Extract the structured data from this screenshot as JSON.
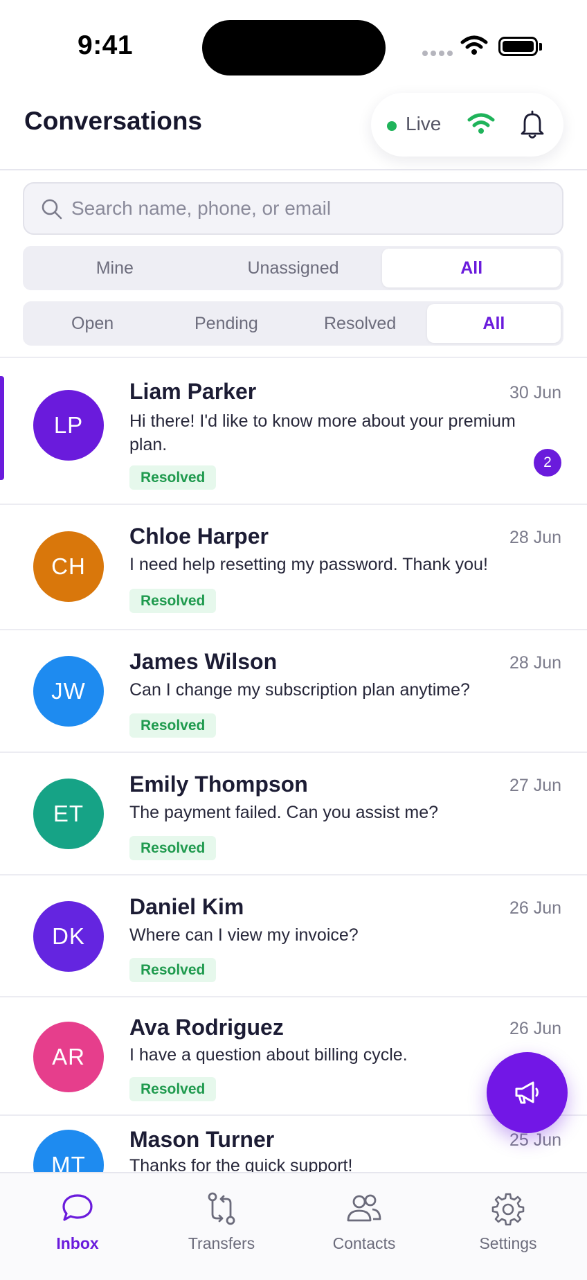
{
  "status_bar": {
    "time": "9:41"
  },
  "header": {
    "title": "Conversations",
    "live_label": "Live"
  },
  "search": {
    "placeholder": "Search name, phone, or email"
  },
  "filters": {
    "assignment": [
      "Mine",
      "Unassigned",
      "All"
    ],
    "assignment_selected": "All",
    "status": [
      "Open",
      "Pending",
      "Resolved",
      "All"
    ],
    "status_selected": "All"
  },
  "conversations": [
    {
      "initials": "LP",
      "name": "Liam Parker",
      "date": "30 Jun",
      "message": "Hi there! I'd like to know more about your premium plan.",
      "status": "Resolved",
      "unread": "2",
      "avatar_color": "#6a1bdc",
      "selected": true
    },
    {
      "initials": "CH",
      "name": "Chloe Harper",
      "date": "28 Jun",
      "message": "I need help resetting my password. Thank you!",
      "status": "Resolved",
      "avatar_color": "#d9770b"
    },
    {
      "initials": "JW",
      "name": "James Wilson",
      "date": "28 Jun",
      "message": "Can I change my subscription plan anytime?",
      "status": "Resolved",
      "avatar_color": "#1e8bf0"
    },
    {
      "initials": "ET",
      "name": "Emily Thompson",
      "date": "27 Jun",
      "message": "The payment failed. Can you assist me?",
      "status": "Resolved",
      "avatar_color": "#16a386"
    },
    {
      "initials": "DK",
      "name": "Daniel Kim",
      "date": "26 Jun",
      "message": "Where can I view my invoice?",
      "status": "Resolved",
      "avatar_color": "#6425e0"
    },
    {
      "initials": "AR",
      "name": "Ava Rodriguez",
      "date": "26 Jun",
      "message": "I have a question about billing cycle.",
      "status": "Resolved",
      "avatar_color": "#e63e8c"
    },
    {
      "initials": "MT",
      "name": "Mason Turner",
      "date": "25 Jun",
      "message": "Thanks for the quick support!",
      "avatar_color": "#1e8bf0"
    }
  ],
  "fab": {
    "icon": "megaphone-icon"
  },
  "nav": [
    {
      "label": "Inbox",
      "icon": "chat-bubble-icon",
      "active": true
    },
    {
      "label": "Transfers",
      "icon": "transfer-icon"
    },
    {
      "label": "Contacts",
      "icon": "contacts-icon"
    },
    {
      "label": "Settings",
      "icon": "gear-icon"
    }
  ],
  "colors": {
    "accent": "#6a1bdc",
    "live": "#1fb35a",
    "resolved_text": "#1f9a4e",
    "resolved_bg": "#e6f8ec"
  }
}
